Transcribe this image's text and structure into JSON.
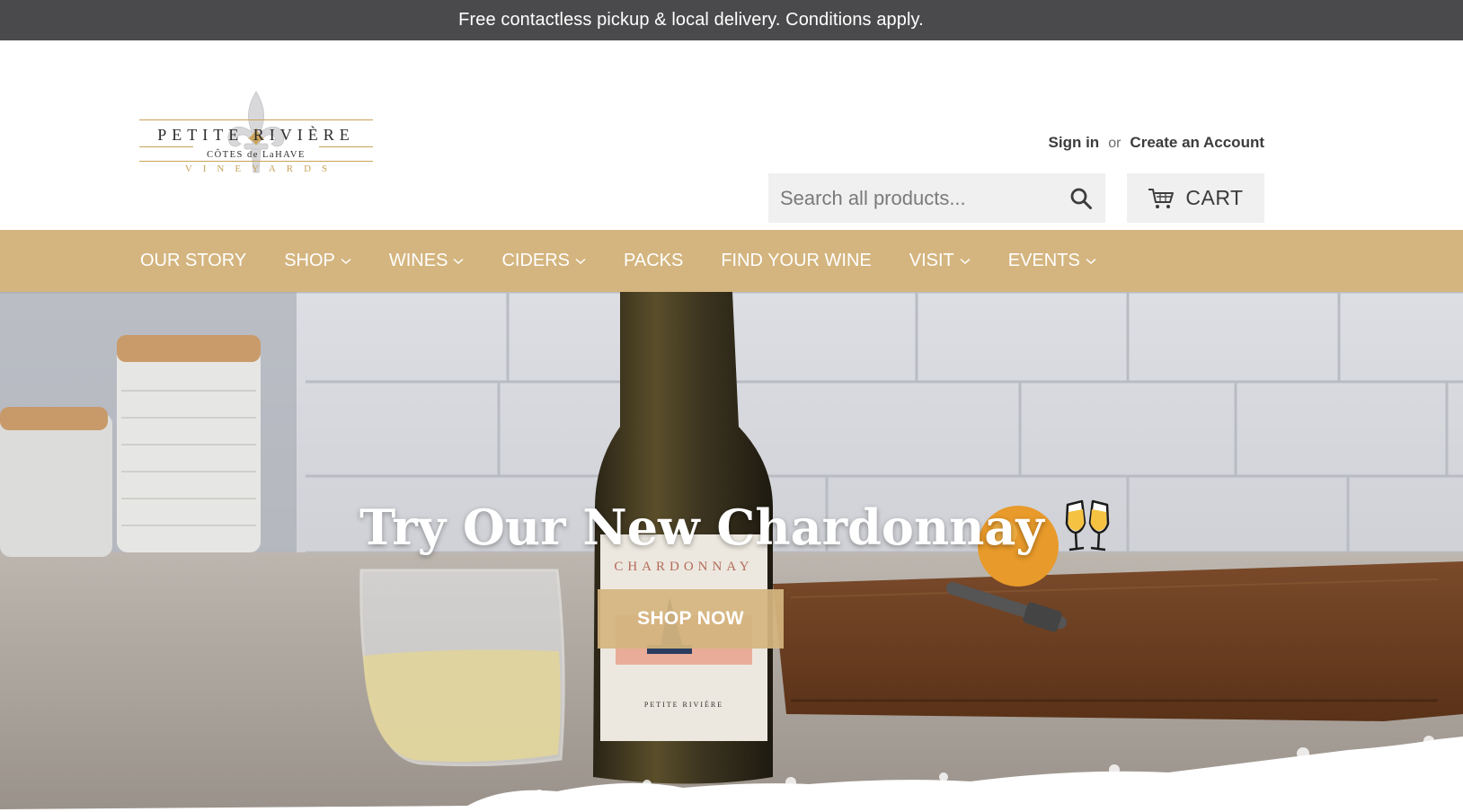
{
  "announcement": {
    "text": "Free contactless pickup & local delivery. Conditions apply."
  },
  "logo": {
    "brand": "PETITE RIVIÈRE",
    "subtitle": "CÔTES de LaHAVE",
    "tagline": "VINEYARDS",
    "icon": "fleur-de-lis-icon"
  },
  "account": {
    "sign_in": "Sign in",
    "or": "or",
    "create_account": "Create an Account"
  },
  "search": {
    "placeholder": "Search all products...",
    "icon": "search-icon"
  },
  "cart": {
    "label": "CART",
    "icon": "cart-icon"
  },
  "nav": {
    "items": [
      {
        "label": "OUR STORY",
        "dropdown": false
      },
      {
        "label": "SHOP",
        "dropdown": true
      },
      {
        "label": "WINES",
        "dropdown": true
      },
      {
        "label": "CIDERS",
        "dropdown": true
      },
      {
        "label": "PACKS",
        "dropdown": false
      },
      {
        "label": "FIND YOUR WINE",
        "dropdown": false
      },
      {
        "label": "VISIT",
        "dropdown": true
      },
      {
        "label": "EVENTS",
        "dropdown": true
      }
    ]
  },
  "hero": {
    "title": "Try Our New Chardonnay",
    "emoji": "🥂",
    "button": "SHOP NOW",
    "bottle_label": "CHARDONNAY",
    "bottle_brand": "PETITE RIVIÈRE"
  },
  "colors": {
    "announcement_bg": "#4a4a4c",
    "nav_bg": "#d4b57f",
    "accent_gold": "#c9a35a",
    "button_bg": "#d4b57f"
  }
}
